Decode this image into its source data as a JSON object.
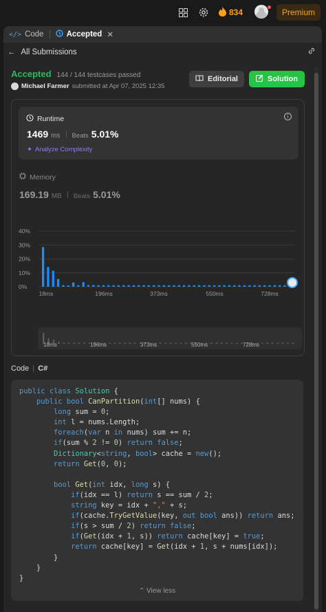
{
  "topbar": {
    "streak_count": "834",
    "premium_label": "Premium",
    "icons": [
      "layout-icon",
      "gear-icon",
      "fire-icon",
      "avatar"
    ]
  },
  "tabs": [
    {
      "label": "Code",
      "icon": "code-icon"
    },
    {
      "label": "Accepted",
      "icon": "history-icon",
      "active": true
    }
  ],
  "nav": {
    "back_label": "All Submissions"
  },
  "submission": {
    "status": "Accepted",
    "testcases": "144 / 144 testcases passed",
    "author": "Michael Farmer",
    "submitted_text": "submitted at Apr 07, 2025 12:35",
    "editorial_label": "Editorial",
    "solution_label": "Solution"
  },
  "runtime": {
    "title": "Runtime",
    "value": "1469",
    "unit": "ms",
    "beats_label": "Beats",
    "beats_pct": "5.01%",
    "analyze_label": "Analyze Complexity"
  },
  "memory": {
    "title": "Memory",
    "value": "169.19",
    "unit": "MB",
    "beats_label": "Beats",
    "beats_pct": "5.01%"
  },
  "chart_data": {
    "type": "bar",
    "ylabels": [
      "40%",
      "30%",
      "20%",
      "10%",
      "0%"
    ],
    "ylim": [
      0,
      40
    ],
    "xticks": [
      "18ms",
      "196ms",
      "373ms",
      "550ms",
      "728ms"
    ],
    "values": [
      28.5,
      14.2,
      11.5,
      5.6,
      1.2,
      1.0,
      3.1,
      1.1,
      3.3,
      1.2,
      1.3,
      1.1,
      1.1,
      1.1,
      1.1,
      1.1,
      1.1,
      1.1,
      1.1,
      1.1,
      1.1,
      1.1,
      1.1,
      1.1,
      1.1,
      1.1,
      1.1,
      1.1,
      1.1,
      1.1,
      1.1,
      1.1,
      1.1,
      1.1,
      1.1,
      1.1,
      1.1,
      1.1,
      1.1,
      1.1,
      1.1,
      1.1,
      1.1,
      1.1,
      1.1,
      1.1,
      1.1,
      1.1,
      1.1,
      1.1
    ],
    "highlight_color": "#1a8cff",
    "grid": true,
    "navigator_ticks": [
      "18ms",
      "196ms",
      "373ms",
      "550ms",
      "728ms"
    ]
  },
  "code": {
    "label": "Code",
    "language": "C#",
    "view_less_label": "View less",
    "lines": [
      "public class Solution {",
      "    public bool CanPartition(int[] nums) {",
      "        long sum = 0;",
      "        int l = nums.Length;",
      "        foreach(var n in nums) sum += n;",
      "        if(sum % 2 != 0) return false;",
      "        Dictionary<string, bool> cache = new();",
      "        return Get(0, 0);",
      "",
      "        bool Get(int idx, long s) {",
      "            if(idx == l) return s == sum / 2;",
      "            string key = idx + \",\" + s;",
      "            if(cache.TryGetValue(key, out bool ans)) return ans;",
      "            if(s > sum / 2) return false;",
      "            if(Get(idx + 1, s)) return cache[key] = true;",
      "            return cache[key] = Get(idx + 1, s + nums[idx]);",
      "        }",
      "    }",
      "}"
    ]
  }
}
